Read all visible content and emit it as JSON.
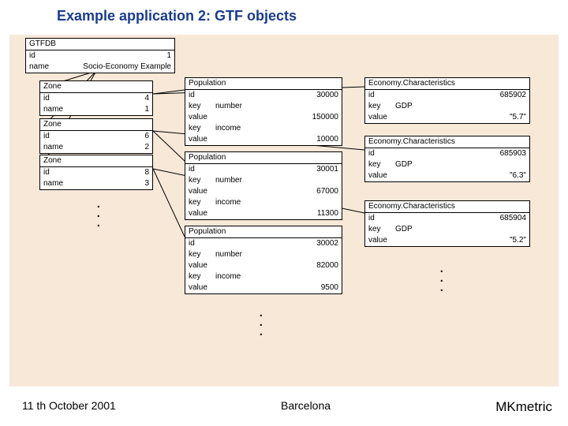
{
  "title": "Example application 2: GTF objects",
  "gtfdb": {
    "header": "GTFDB",
    "id_label": "id",
    "id_value": "1",
    "name_label": "name",
    "name_value": "Socio-Economy Example"
  },
  "zones": [
    {
      "header": "Zone",
      "id_label": "id",
      "id_value": "4",
      "name_label": "name",
      "name_value": "1"
    },
    {
      "header": "Zone",
      "id_label": "id",
      "id_value": "6",
      "name_label": "name",
      "name_value": "2"
    },
    {
      "header": "Zone",
      "id_label": "id",
      "id_value": "8",
      "name_label": "name",
      "name_value": "3"
    }
  ],
  "populations": [
    {
      "header": "Population",
      "rows": [
        {
          "l": "id",
          "v": "30000"
        },
        {
          "l": "key",
          "m": "number",
          "v": ""
        },
        {
          "l": "value",
          "v": "150000"
        },
        {
          "l": "key",
          "m": "income",
          "v": ""
        },
        {
          "l": "value",
          "v": "10000"
        }
      ]
    },
    {
      "header": "Population",
      "rows": [
        {
          "l": "id",
          "v": "30001"
        },
        {
          "l": "key",
          "m": "number",
          "v": ""
        },
        {
          "l": "value",
          "v": "67000"
        },
        {
          "l": "key",
          "m": "income",
          "v": ""
        },
        {
          "l": "value",
          "v": "11300"
        }
      ]
    },
    {
      "header": "Population",
      "rows": [
        {
          "l": "id",
          "v": "30002"
        },
        {
          "l": "key",
          "m": "number",
          "v": ""
        },
        {
          "l": "value",
          "v": "82000"
        },
        {
          "l": "key",
          "m": "income",
          "v": ""
        },
        {
          "l": "value",
          "v": "9500"
        }
      ]
    }
  ],
  "economies": [
    {
      "header": "Economy.Characteristics",
      "rows": [
        {
          "l": "id",
          "v": "685902"
        },
        {
          "l": "key",
          "m": "GDP",
          "v": ""
        },
        {
          "l": "value",
          "v": "\"5.7\""
        }
      ]
    },
    {
      "header": "Economy.Characteristics",
      "rows": [
        {
          "l": "id",
          "v": "685903"
        },
        {
          "l": "key",
          "m": "GDP",
          "v": ""
        },
        {
          "l": "value",
          "v": "\"6.3\""
        }
      ]
    },
    {
      "header": "Economy.Characteristics",
      "rows": [
        {
          "l": "id",
          "v": "685904"
        },
        {
          "l": "key",
          "m": "GDP",
          "v": ""
        },
        {
          "l": "value",
          "v": "\"5.2\""
        }
      ]
    }
  ],
  "footer": {
    "date": "11 th October 2001",
    "place": "Barcelona",
    "brand": "MKmetric"
  },
  "dot": "."
}
